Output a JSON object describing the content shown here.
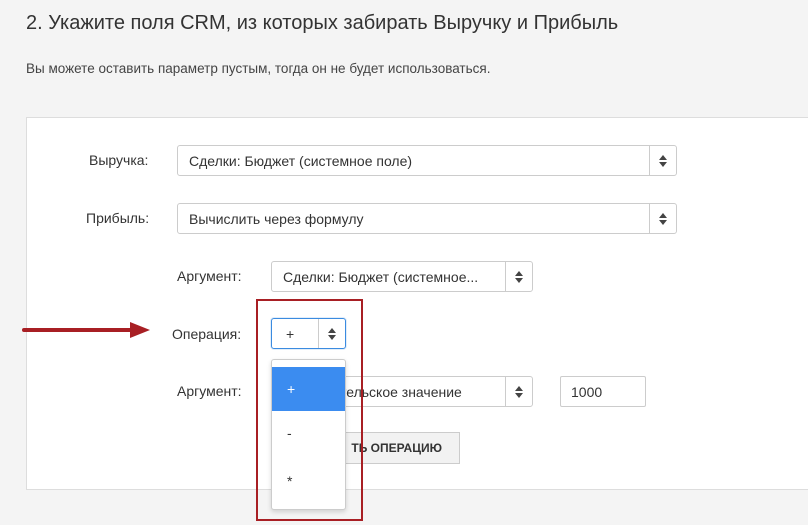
{
  "header": {
    "title": "2. Укажите поля CRM, из которых забирать Выручку и Прибыль",
    "subtitle": "Вы можете оставить параметр пустым, тогда он не будет использоваться."
  },
  "form": {
    "revenue": {
      "label": "Выручка:",
      "value": "Сделки: Бюджет (системное поле)"
    },
    "profit": {
      "label": "Прибыль:",
      "value": "Вычислить через формулу"
    },
    "argument1": {
      "label": "Аргумент:",
      "value": "Сделки: Бюджет (системное..."
    },
    "operation": {
      "label": "Операция:",
      "value": "+"
    },
    "argument2": {
      "label": "Аргумент:",
      "value": "тельское значение",
      "custom_value": "1000"
    },
    "add_operation_button": "ТЬ ОПЕРАЦИЮ"
  },
  "operation_dropdown": {
    "options": [
      "+",
      "-",
      "*"
    ],
    "selected_index": 0
  },
  "colors": {
    "accent": "#3b8cf0",
    "annotation": "#a81f24"
  }
}
